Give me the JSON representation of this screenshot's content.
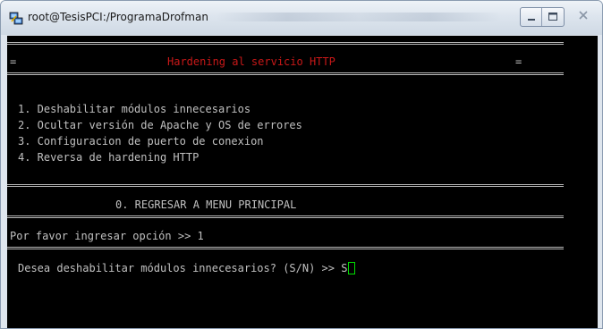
{
  "window": {
    "title": "root@TesisPCI:/ProgramaDrofman"
  },
  "terminal": {
    "header_left_marker": "=",
    "header_title": "Hardening al servicio HTTP",
    "header_right_marker": "=",
    "menu_items": [
      "1. Deshabilitar módulos innecesarios",
      "2. Ocultar versión de Apache y OS de errores",
      "3. Configuracion de puerto de conexion",
      "4. Reversa de hardening HTTP"
    ],
    "return_option": "0. REGRESAR A MENU PRINCIPAL",
    "prompt_text": "Por favor ingresar opción >> 1",
    "question_text": "Desea deshabilitar módulos innecesarios? (S/N) >> S"
  },
  "colors": {
    "terminal_bg": "#000000",
    "terminal_text": "#c0c0c0",
    "header_title": "#c81818",
    "cursor": "#00dd00"
  },
  "icons": {
    "app": "putty-terminal-icon",
    "minimize": "minimize-icon",
    "maximize": "maximize-icon",
    "close": "close-icon"
  }
}
